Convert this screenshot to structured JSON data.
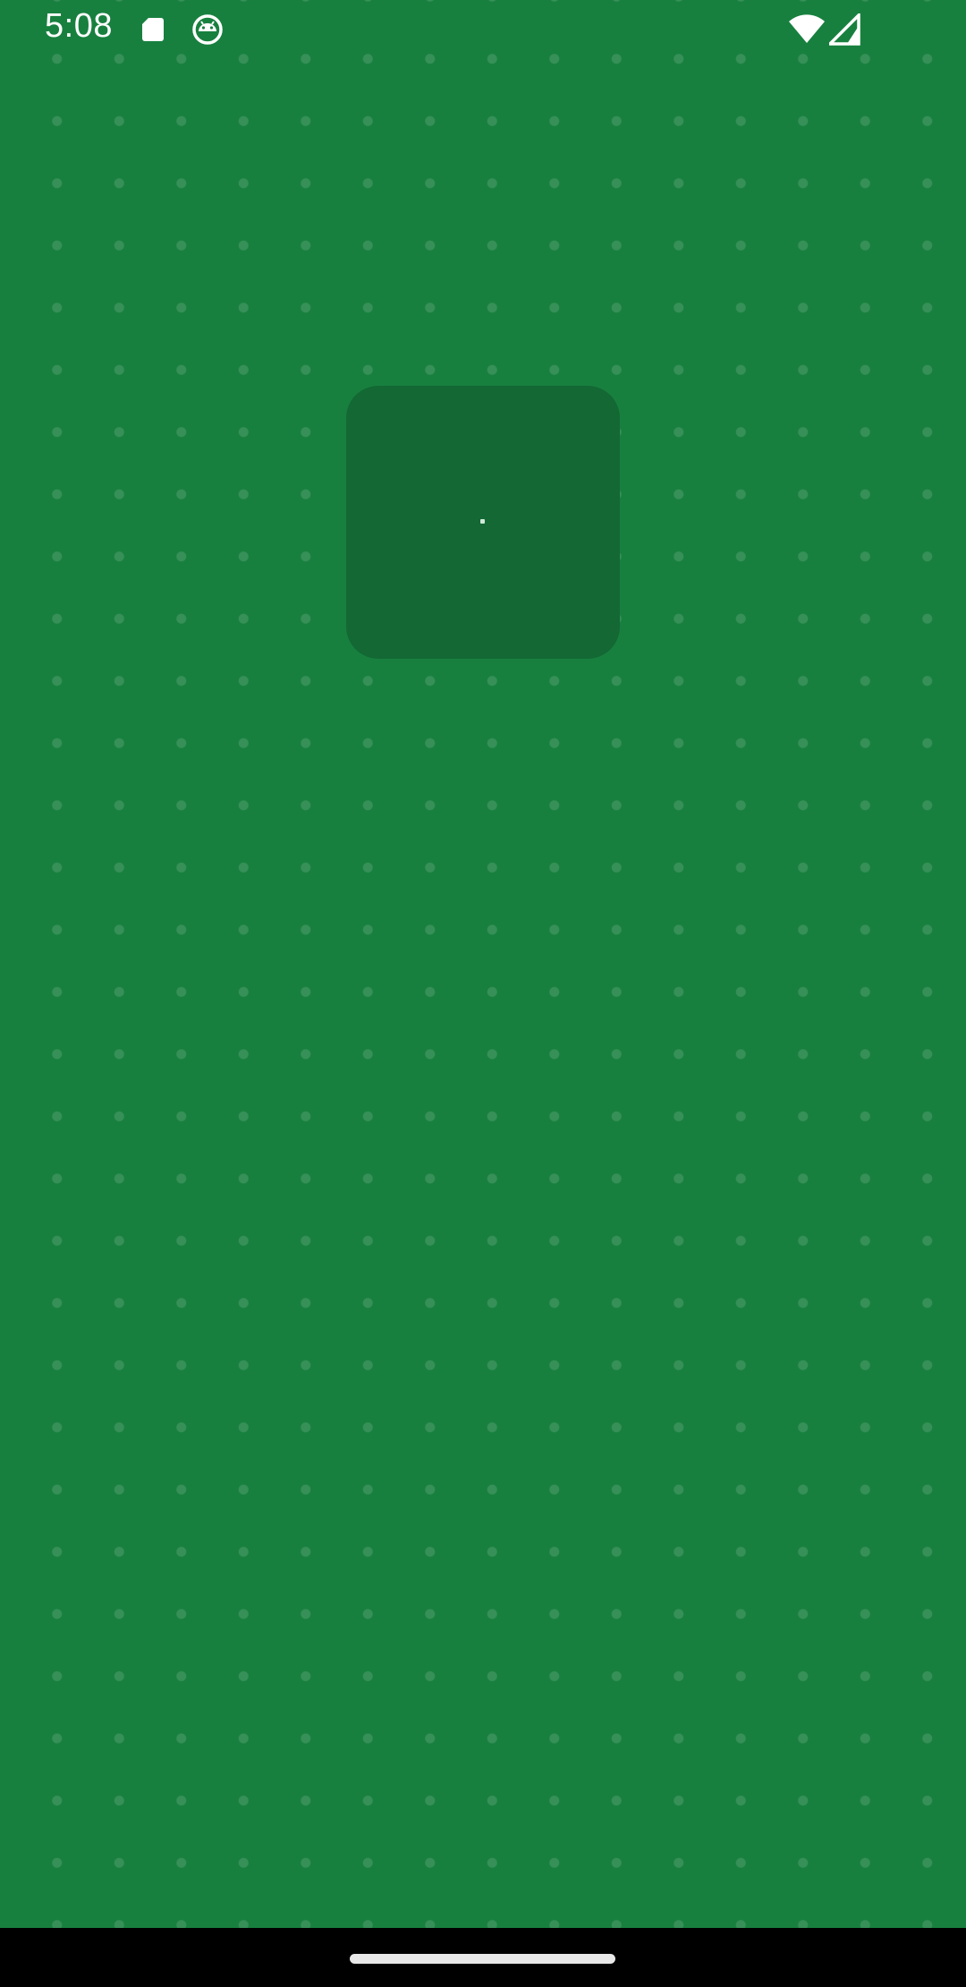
{
  "status_bar": {
    "time": "5:08",
    "left_icons": [
      "sd-card-icon",
      "android-robot-icon"
    ],
    "right_icons": [
      "wifi-icon",
      "cellular-signal-icon"
    ]
  },
  "screen": {
    "background_color": "#18803f",
    "tile_color": "#136834"
  },
  "navigation_bar": {
    "icons": [
      "home-handle"
    ]
  }
}
